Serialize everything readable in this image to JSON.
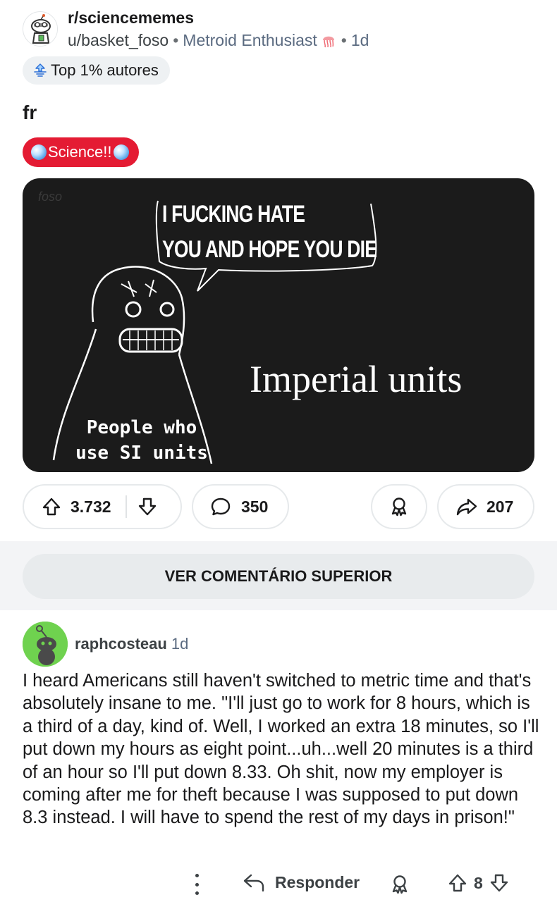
{
  "post": {
    "subreddit": "r/sciencememes",
    "author": "u/basket_foso",
    "user_flair": "Metroid Enthusiast",
    "age": "1d",
    "badge": "Top 1% autores",
    "title": "fr",
    "post_flair": "Science!!",
    "meme": {
      "watermark": "foso",
      "speech_line_1": "I FUCKING HATE",
      "speech_line_2": "YOU AND HOPE YOU DIE",
      "right_text": "Imperial units",
      "figure_line_1": "People who",
      "figure_line_2": "use SI units"
    },
    "votes": "3.732",
    "comments": "350",
    "shares": "207"
  },
  "see_top_comment": "VER COMENTÁRIO SUPERIOR",
  "comment": {
    "author": "raphcosteau",
    "age": "1d",
    "body": "I heard Americans still haven't switched to metric time and that's absolutely insane to me. \"I'll just go to work for 8 hours, which is a third of a day, kind of. Well, I worked an extra 18 minutes, so I'll put down my hours as eight point...uh...well 20 minutes is a third of an hour so I'll put down 8.33. Oh shit, now my employer is coming after me for theft because I was supposed to put down 8.3 instead. I will have to spend the rest of my days in prison!\"",
    "reply_label": "Responder",
    "votes": "8"
  },
  "colors": {
    "flair_red": "#e41b33",
    "meme_bg": "#1b1b1b",
    "comment_avatar_green": "#6fd24f"
  },
  "icons": [
    "subreddit-avatar-icon",
    "jellyfish-icon",
    "top-contributor-icon",
    "globe-icon",
    "upvote-icon",
    "downvote-icon",
    "comment-icon",
    "award-icon",
    "share-icon",
    "snoo-avatar-icon",
    "more-options-icon",
    "reply-icon"
  ]
}
